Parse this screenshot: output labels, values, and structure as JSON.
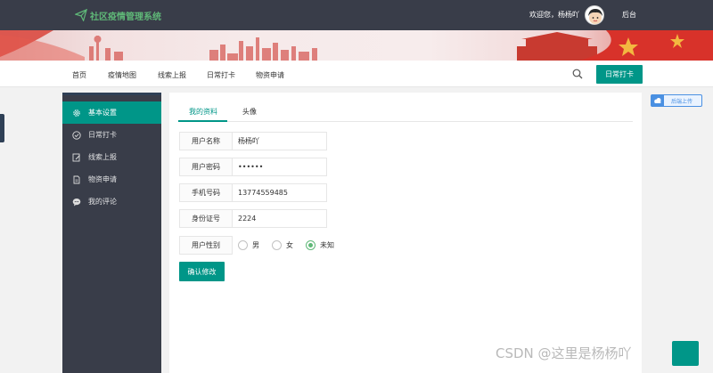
{
  "header": {
    "logo_text": "社区疫情管理系统",
    "welcome_text": "欢迎您，杨杨吖",
    "backend_link": "后台"
  },
  "nav": {
    "items": [
      "首页",
      "疫情地图",
      "线索上报",
      "日常打卡",
      "物资申请"
    ],
    "checkin_button": "日常打卡"
  },
  "sidebar": {
    "items": [
      {
        "label": "基本设置",
        "icon": "gear-icon",
        "active": true
      },
      {
        "label": "日常打卡",
        "icon": "check-circle-icon",
        "active": false
      },
      {
        "label": "线索上报",
        "icon": "edit-icon",
        "active": false
      },
      {
        "label": "物资申请",
        "icon": "document-icon",
        "active": false
      },
      {
        "label": "我的评论",
        "icon": "comment-icon",
        "active": false
      }
    ]
  },
  "tabs": [
    "我的资料",
    "头像"
  ],
  "form": {
    "username_label": "用户名称",
    "username_value": "杨杨吖",
    "password_label": "用户密码",
    "password_value": "••••••",
    "phone_label": "手机号码",
    "phone_value": "13774559485",
    "idcard_label": "身份证号",
    "idcard_value": "2224",
    "gender_label": "用户性别",
    "gender_options": [
      "男",
      "女",
      "未知"
    ],
    "gender_selected": "未知",
    "submit_label": "确认修改"
  },
  "side_badge": "后端上传",
  "watermark": "CSDN @这里是杨杨吖",
  "colors": {
    "accent": "#009688",
    "header_bg": "#393d49",
    "logo_green": "#5fb878"
  }
}
